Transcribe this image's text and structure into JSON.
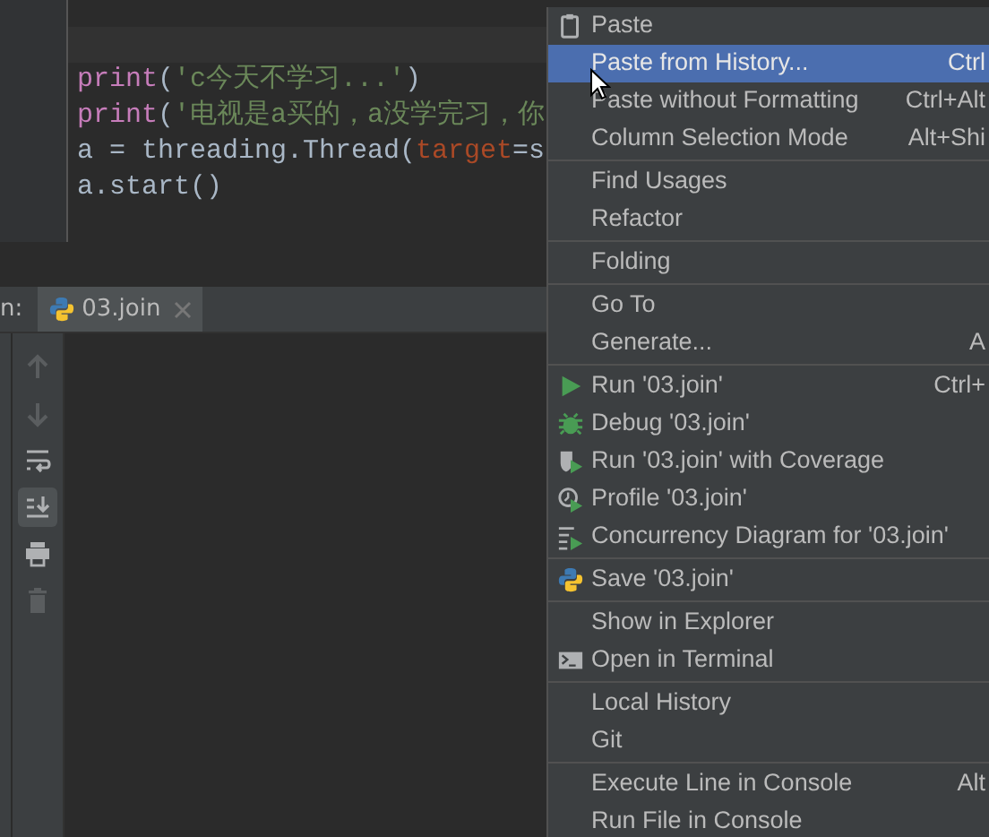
{
  "editor": {
    "lines": [
      [
        {
          "text": "print",
          "kind": "builtin"
        },
        {
          "text": "(",
          "kind": "plain"
        },
        {
          "text": "'c今天不学习...'",
          "kind": "string"
        },
        {
          "text": ")",
          "kind": "plain"
        }
      ],
      [
        {
          "text": "print",
          "kind": "builtin"
        },
        {
          "text": "(",
          "kind": "plain"
        },
        {
          "text": "'电视是a买的，a没学完习，你",
          "kind": "string"
        }
      ],
      [
        {
          "text": "a = threading.Thread(",
          "kind": "plain"
        },
        {
          "text": "target",
          "kind": "param"
        },
        {
          "text": "=s",
          "kind": "plain"
        }
      ],
      [
        {
          "text": "a.start()",
          "kind": "plain"
        }
      ]
    ]
  },
  "run_panel": {
    "label": "n:",
    "tabs": [
      {
        "label": "03.join",
        "selected": true,
        "closable": true
      }
    ],
    "toolbar": [
      {
        "kind": "up",
        "disabled": true,
        "on": false
      },
      {
        "kind": "down",
        "disabled": true,
        "on": false
      },
      {
        "kind": "wrap",
        "disabled": false,
        "on": false
      },
      {
        "kind": "scroll-end",
        "disabled": false,
        "on": true
      },
      {
        "kind": "print",
        "disabled": false,
        "on": false
      },
      {
        "kind": "delete",
        "disabled": true,
        "on": false
      }
    ]
  },
  "context_menu": {
    "groups": [
      [
        {
          "label": "Paste",
          "kind": "paste",
          "selected": false
        },
        {
          "label": "Paste from History...",
          "shortcut": "Ctrl",
          "kind": "plain",
          "selected": true
        },
        {
          "label": "Paste without Formatting",
          "shortcut": "Ctrl+Alt",
          "kind": "plain",
          "selected": false
        },
        {
          "label": "Column Selection Mode",
          "shortcut": "Alt+Shi",
          "kind": "plain",
          "selected": false
        }
      ],
      [
        {
          "label": "Find Usages",
          "kind": "plain",
          "selected": false
        },
        {
          "label": "Refactor",
          "kind": "plain",
          "selected": false
        }
      ],
      [
        {
          "label": "Folding",
          "kind": "plain",
          "selected": false
        }
      ],
      [
        {
          "label": "Go To",
          "kind": "plain",
          "selected": false
        },
        {
          "label": "Generate...",
          "shortcut": "A",
          "kind": "plain",
          "selected": false
        }
      ],
      [
        {
          "label": "Run '03.join'",
          "shortcut": "Ctrl+",
          "kind": "run",
          "selected": false
        },
        {
          "label": "Debug '03.join'",
          "kind": "debug",
          "selected": false
        },
        {
          "label": "Run '03.join' with Coverage",
          "kind": "coverage",
          "selected": false
        },
        {
          "label": "Profile '03.join'",
          "kind": "profile",
          "selected": false
        },
        {
          "label": "Concurrency Diagram for '03.join'",
          "kind": "concurrency",
          "selected": false
        }
      ],
      [
        {
          "label": "Save '03.join'",
          "kind": "python",
          "selected": false
        }
      ],
      [
        {
          "label": "Show in Explorer",
          "kind": "plain",
          "selected": false
        },
        {
          "label": "Open in Terminal",
          "kind": "terminal",
          "selected": false
        }
      ],
      [
        {
          "label": "Local History",
          "kind": "plain",
          "selected": false
        },
        {
          "label": "Git",
          "kind": "plain",
          "selected": false
        }
      ],
      [
        {
          "label": "Execute Line in Console",
          "shortcut": "Alt",
          "kind": "plain",
          "selected": false
        },
        {
          "label": "Run File in Console",
          "kind": "plain",
          "selected": false
        }
      ]
    ]
  }
}
